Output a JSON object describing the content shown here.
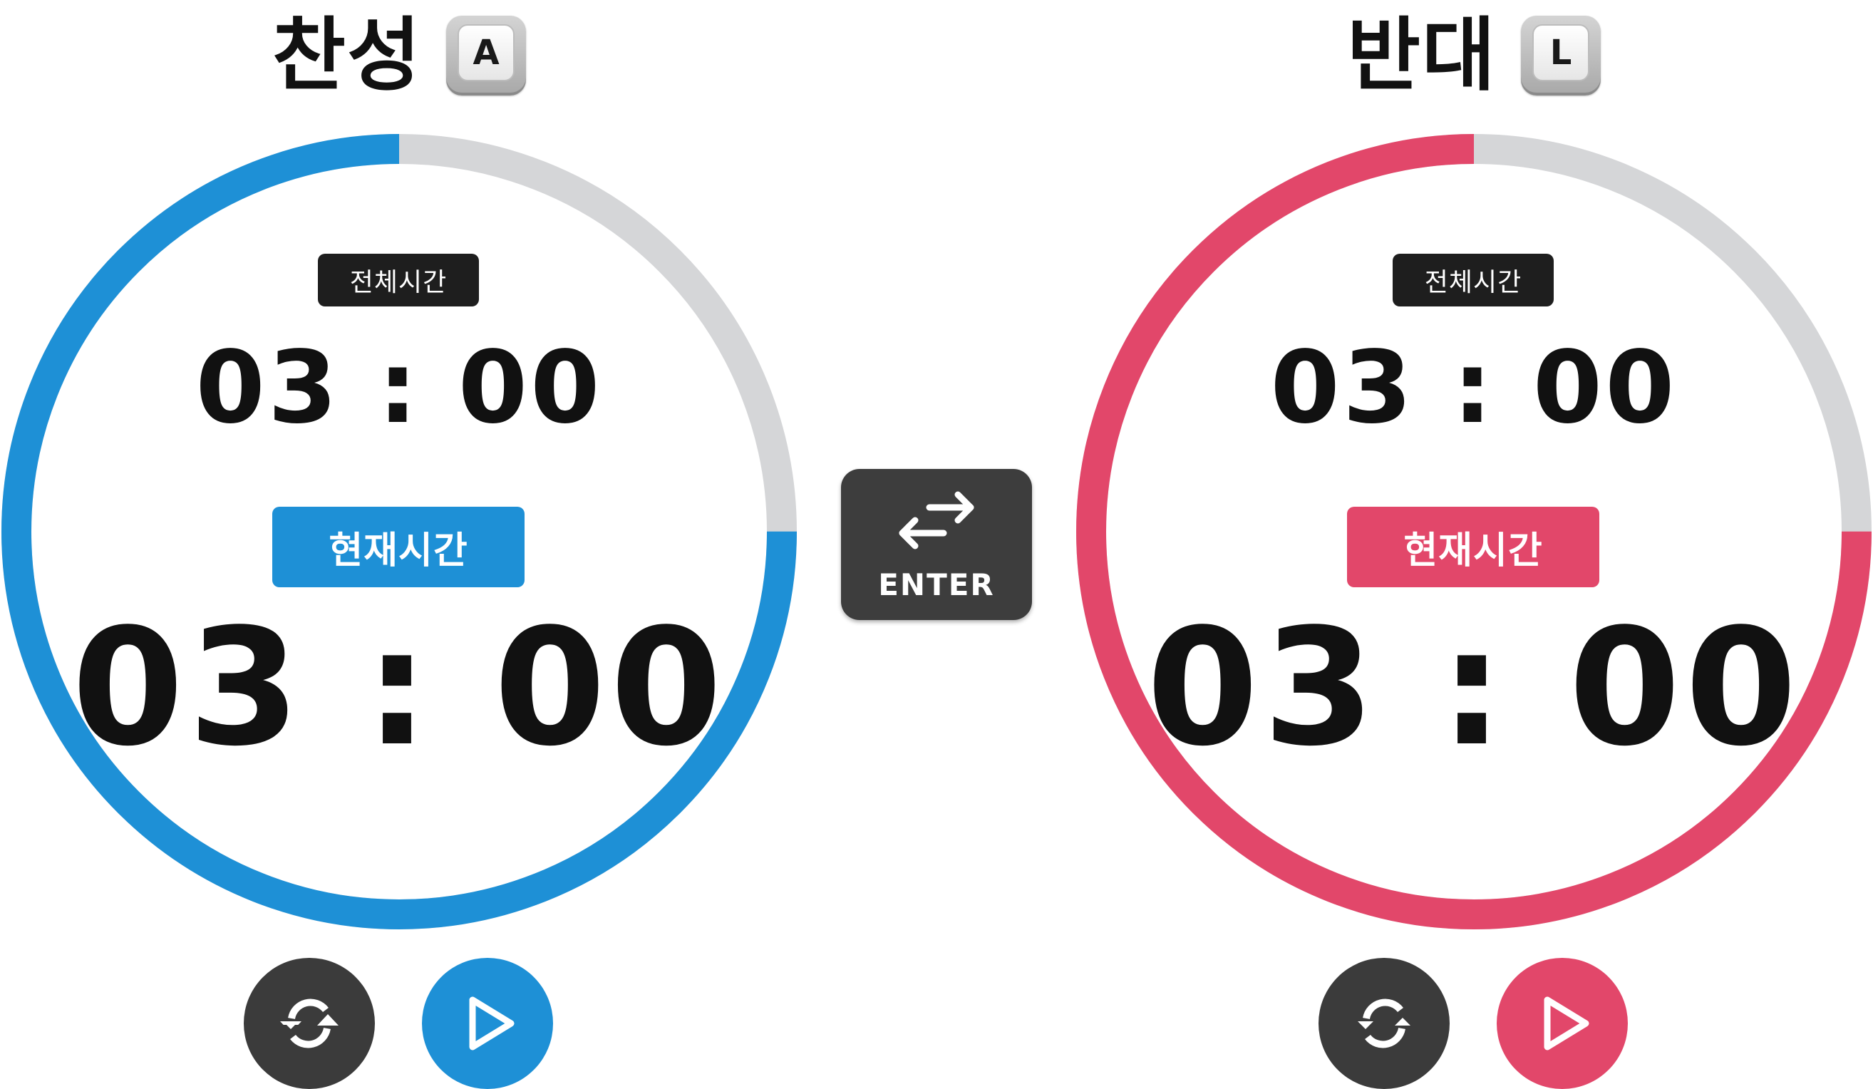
{
  "colors": {
    "pro": "#1e90d6",
    "con": "#e2476a",
    "track": "#d5d6d8",
    "dark": "#3b3b3b",
    "label_dark": "#1e1e1e"
  },
  "panels": [
    {
      "title": "찬성",
      "hotkey": "A",
      "total_label": "전체시간",
      "total_time": "03 : 00",
      "current_label": "현재시간",
      "current_time": "03 : 00",
      "progress_fraction": 0.75,
      "progress_color": "#1e90d6",
      "reset_icon": "refresh-icon",
      "play_icon": "play-icon"
    },
    {
      "title": "반대",
      "hotkey": "L",
      "total_label": "전체시간",
      "total_time": "03 : 00",
      "current_label": "현재시간",
      "current_time": "03 : 00",
      "progress_fraction": 0.75,
      "progress_color": "#e2476a",
      "reset_icon": "refresh-icon",
      "play_icon": "play-icon"
    }
  ],
  "swap_key": {
    "label": "ENTER",
    "icon": "swap-arrows-icon"
  }
}
